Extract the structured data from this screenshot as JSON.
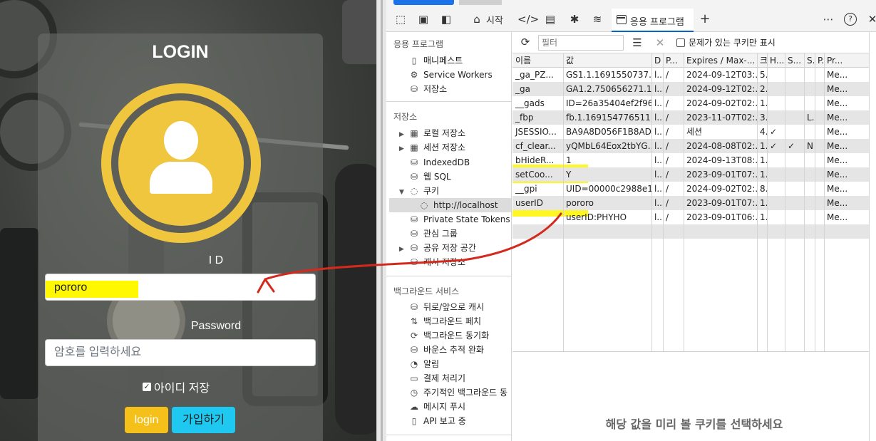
{
  "login": {
    "title": "LOGIN",
    "id_label": "I D",
    "id_value": "pororo",
    "password_label": "Password",
    "password_placeholder": "암호를 입력하세요",
    "remember_label": "아이디 저장",
    "login_button": "login",
    "join_button": "가입하기"
  },
  "devtools": {
    "tabs": [
      "시작",
      "응용 프로그램"
    ],
    "sidebar": {
      "app_header": "응용 프로그램",
      "app_items": [
        "매니페스트",
        "Service Workers",
        "저장소"
      ],
      "storage_header": "저장소",
      "storage_items": [
        "로컬 저장소",
        "세션 저장소",
        "IndexedDB",
        "웹 SQL",
        "쿠키",
        "http://localhost",
        "Private State Tokens",
        "관심 그룹",
        "공유 저장 공간",
        "캐시 저장소"
      ],
      "bg_header": "백그라운드 서비스",
      "bg_items": [
        "뒤로/앞으로 캐시",
        "백그라운드 페치",
        "백그라운드 동기화",
        "바운스 추적 완화",
        "알림",
        "결제 처리기",
        "주기적인 백그라운드 동",
        "메시지 푸시",
        "API 보고 중"
      ]
    },
    "filter": {
      "placeholder": "필터",
      "only_issues_label": "문제가 있는 쿠키만 표시"
    },
    "columns": [
      "이름",
      "값",
      "D",
      "P...",
      "Expires / Max-...",
      "크",
      "H...",
      "S...",
      "S.",
      "P.",
      "Pr..."
    ],
    "rows": [
      [
        "_ga_PZ...",
        "GS1.1.1691550737....",
        "l...",
        "/",
        "2024-09-12T03:...",
        "5.",
        "",
        "",
        "",
        "",
        "Me..."
      ],
      [
        "_ga",
        "GA1.2.750656271.1...",
        "l...",
        "/",
        "2024-09-12T02:...",
        "2.",
        "",
        "",
        "",
        "",
        "Me..."
      ],
      [
        "__gads",
        "ID=26a35404ef2f96...",
        "l...",
        "/",
        "2024-09-02T02:...",
        "1.",
        "",
        "",
        "",
        "",
        "Me..."
      ],
      [
        "_fbp",
        "fb.1.169154776511...",
        "l...",
        "/",
        "2023-11-07T02:...",
        "3.",
        "",
        "",
        "L.",
        "",
        "Me..."
      ],
      [
        "JSESSIO...",
        "BA9A8D056F1B8AD...",
        "l...",
        "/",
        "세션",
        "4.",
        "✓",
        "",
        "",
        "",
        "Me..."
      ],
      [
        "cf_clear...",
        "yQMbL64Eox2tbYG...",
        "l...",
        "/",
        "2024-08-08T02:...",
        "1.",
        "✓",
        "✓",
        "N",
        "",
        "Me..."
      ],
      [
        "bHideR...",
        "1",
        "l...",
        "/",
        "2024-09-13T08:...",
        "1.",
        "",
        "",
        "",
        "",
        "Me..."
      ],
      [
        "setCoo...",
        "Y",
        "l...",
        "/",
        "2023-09-01T07:...",
        "1.",
        "",
        "",
        "",
        "",
        "Me..."
      ],
      [
        "__gpi",
        "UID=00000c2988e1...",
        "l...",
        "/",
        "2024-09-02T02:...",
        "8.",
        "",
        "",
        "",
        "",
        "Me..."
      ],
      [
        "userID",
        "pororo",
        "l...",
        "/",
        "2023-09-01T07:...",
        "1.",
        "",
        "",
        "",
        "",
        "Me..."
      ],
      [
        "",
        "userID:PHYHO",
        "l...",
        "/",
        "2023-09-01T06:...",
        "1.",
        "",
        "",
        "",
        "",
        "Me..."
      ]
    ],
    "preview_message": "해당 값을 미리 볼 쿠키를 선택하세요"
  },
  "colors": {
    "highlight": "#fff400",
    "annotation_arrow": "#d42a1e",
    "accent": "#0a64c8",
    "login_button": "#f5c01a",
    "join_button": "#1ec8f0",
    "avatar": "#f0c63e"
  }
}
